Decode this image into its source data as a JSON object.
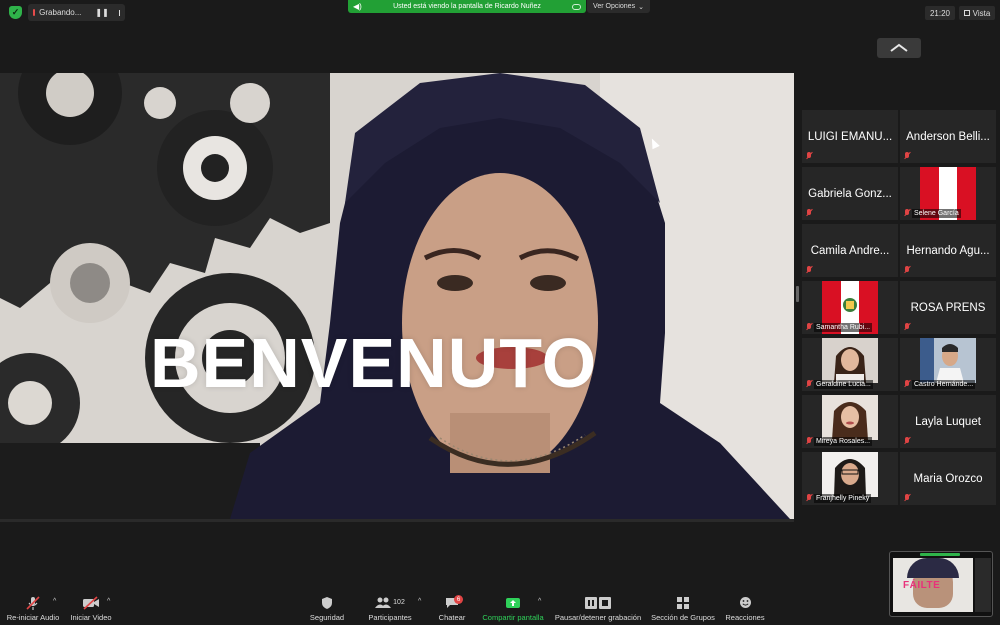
{
  "recording": {
    "label": "Grabando...",
    "pause_icon": "pause-icon",
    "stop_icon": "stop-icon"
  },
  "share_banner": {
    "text": "Usted está viendo la pantalla de Ricardo Nuñez",
    "color": "#22a035"
  },
  "view_options": {
    "label": "Ver Opciones",
    "caret": "⌄"
  },
  "clock": "21:20",
  "view_button": {
    "label": "Vista"
  },
  "shared_screen": {
    "headline": "BENVENUTO"
  },
  "gallery": [
    {
      "name": "LUIGI EMANU...",
      "label": ""
    },
    {
      "name": "Anderson Belli...",
      "label": ""
    },
    {
      "name": "Gabriela Gonz...",
      "label": ""
    },
    {
      "name": "",
      "label": "Selene García",
      "avatar": "peru-flag"
    },
    {
      "name": "Camila Andre...",
      "label": ""
    },
    {
      "name": "Hernando Agu...",
      "label": ""
    },
    {
      "name": "",
      "label": "Samantha Rubi...",
      "avatar": "peru-coat-of-arms-flag"
    },
    {
      "name": "ROSA PRENS",
      "label": ""
    },
    {
      "name": "",
      "label": "Geraldine Lucia...",
      "avatar": "user-photo"
    },
    {
      "name": "",
      "label": "Castro Hernánde...",
      "avatar": "user-photo"
    },
    {
      "name": "",
      "label": "Mireya Rosales...",
      "avatar": "user-photo"
    },
    {
      "name": "Layla Luquet",
      "label": ""
    },
    {
      "name": "",
      "label": "Franjhelly Pineky",
      "avatar": "user-photo"
    },
    {
      "name": "Maria Orozco",
      "label": ""
    }
  ],
  "self_view": {
    "text": "FÁILTE"
  },
  "toolbar": {
    "audio": "Re-iniciar Audio",
    "video": "Iniciar Video",
    "security": "Seguridad",
    "participants": "Participantes",
    "participants_count": "102",
    "chat": "Chatear",
    "chat_badge": "6",
    "share": "Compartir pantalla",
    "record": "Pausar/detener grabación",
    "breakout": "Sección de Grupos",
    "reactions": "Reacciones"
  },
  "colors": {
    "muted_red": "#e04444",
    "share_green": "#2fd15a",
    "bg": "#1a1a1a",
    "tile_bg": "#262626"
  }
}
